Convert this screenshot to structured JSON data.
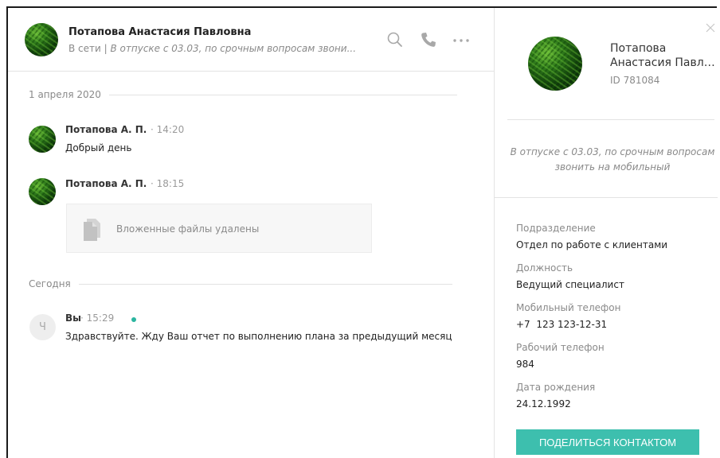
{
  "header": {
    "name": "Потапова Анастасия Павловна",
    "status_online": "В сети",
    "status_separator": " | ",
    "status_away": "В отпуске с 03.03, по срочным вопросам звони..."
  },
  "icons": {
    "search": "search-icon",
    "phone": "phone-icon",
    "more": "more-icon",
    "close": "close-icon",
    "file": "file-icon"
  },
  "chat": {
    "date1": "1 апреля 2020",
    "date2": "Сегодня",
    "messages": [
      {
        "author": "Потапова А. П.",
        "time": "· 14:20",
        "text": "Добрый день"
      },
      {
        "author": "Потапова А. П.",
        "time": "· 18:15",
        "attachment": "Вложенные файлы удалены"
      },
      {
        "author": "Вы",
        "time": "· 15:29",
        "text": "Здравствуйте. Жду Ваш отчет по выполнению плана за предыдущий месяц",
        "avatar_letter": "Ч"
      }
    ]
  },
  "profile": {
    "name_line1": "Потапова",
    "name_line2": "Анастасия Павло...",
    "id": "ID 781084",
    "status": "В отпуске с 03.03, по срочным вопросам звонить на мобильный",
    "fields": [
      {
        "label": "Подразделение",
        "value": "Отдел по работе с клиентами"
      },
      {
        "label": "Должность",
        "value": "Ведущий специалист"
      },
      {
        "label": "Мобильный телефон",
        "value": "+7  123 123-12-31"
      },
      {
        "label": "Рабочий телефон",
        "value": "984"
      },
      {
        "label": "Дата рождения",
        "value": "24.12.1992"
      }
    ],
    "share_button": "ПОДЕЛИТЬСЯ КОНТАКТОМ"
  },
  "colors": {
    "accent": "#3dbfae",
    "online": "#2bb5a0"
  }
}
